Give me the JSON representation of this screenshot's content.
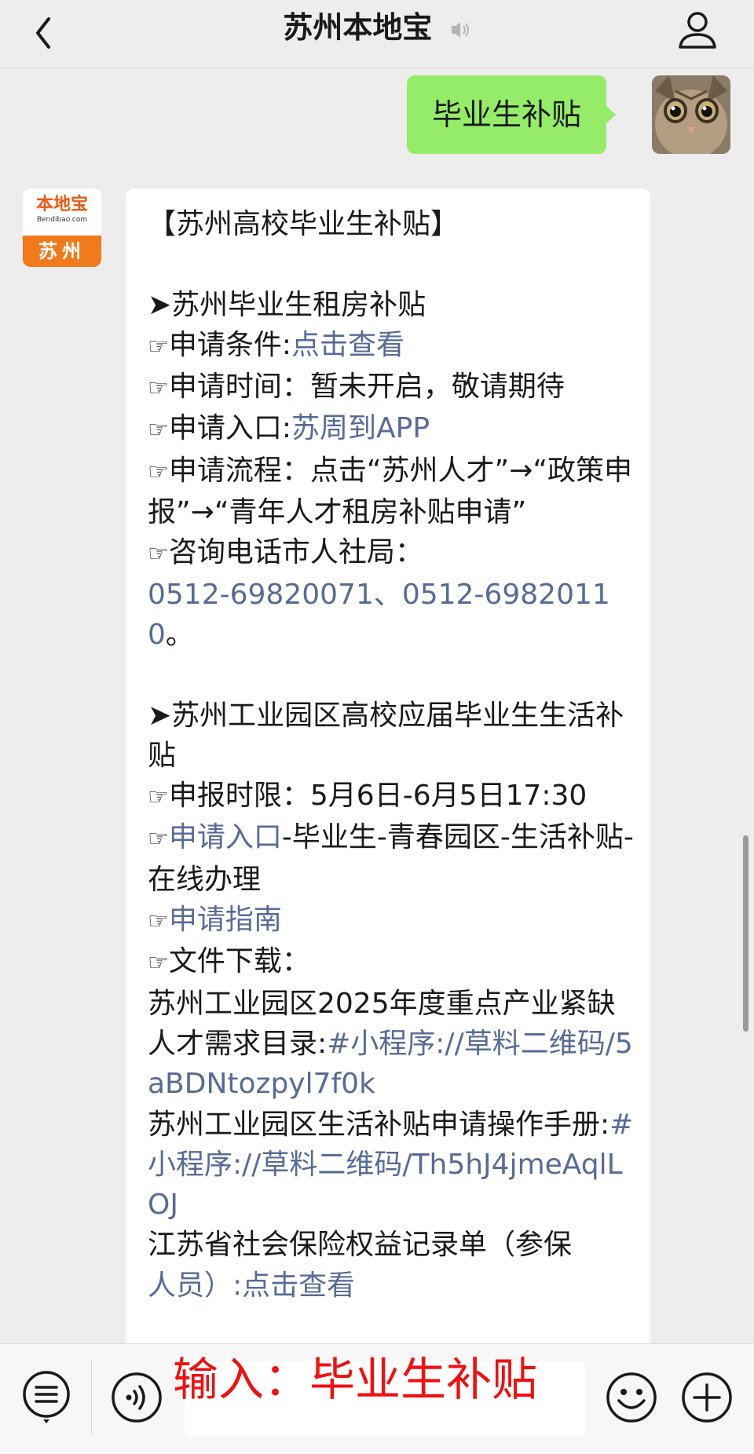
{
  "header": {
    "title": "苏州本地宝",
    "back_icon": "chevron-left-icon",
    "mute_icon": "speaker-icon",
    "profile_icon": "person-icon"
  },
  "outgoing": {
    "text": "毕业生补贴",
    "avatar": "cat-photo-avatar"
  },
  "bot": {
    "avatar_main": "本地宝",
    "avatar_sub": "Bendibao.com",
    "avatar_city": "苏州"
  },
  "message": {
    "title": "【苏州高校毕业生补贴】",
    "s1_head": "➤苏州毕业生租房补贴",
    "hand": "☞",
    "s1_l1_label": "申请条件:",
    "s1_l1_link": "点击查看",
    "s1_l2": "申请时间：暂未开启，敬请期待",
    "s1_l3_label": "申请入口:",
    "s1_l3_link": "苏周到APP",
    "s1_l4": "申请流程：点击“苏州人才”→“政策申报”→“青年人才租房补贴申请”",
    "s1_l5": "咨询电话市人社局：",
    "s1_phone": "0512-69820071、0512-69820110",
    "s1_phone_end": "。",
    "s2_head": "➤苏州工业园区高校应届毕业生生活补贴",
    "s2_l1": "申报时限：5月6日-6月5日17:30",
    "s2_l2_link": "申请入口",
    "s2_l2_rest": "-毕业生-青春园区-生活补贴-在线办理",
    "s2_l3_link": "申请指南",
    "s2_l4": "文件下载：",
    "s2_f1": "苏州工业园区2025年度重点产业紧缺人才需求目录:",
    "s2_f1_link": "#小程序://草料二维码/5aBDNtozpyl7f0k",
    "s2_f2": "苏州工业园区生活补贴申请操作手册:",
    "s2_f2_link": "#小程序://草料二维码/Th5hJ4jmeAqlLOJ",
    "s2_f3": "江苏省社会保险权益记录单（参保",
    "s2_f3_cut": "人员）:点击查看"
  },
  "input_bar": {
    "menu_icon": "list-menu-icon",
    "voice_icon": "voice-icon",
    "emoji_icon": "smiley-icon",
    "plus_icon": "plus-icon",
    "overlay_text": "输入：毕业生补贴"
  },
  "colors": {
    "link": "#576b95",
    "outgoing_bubble": "#95ec69",
    "overlay": "#f01010",
    "brand_orange": "#f07a1c"
  }
}
